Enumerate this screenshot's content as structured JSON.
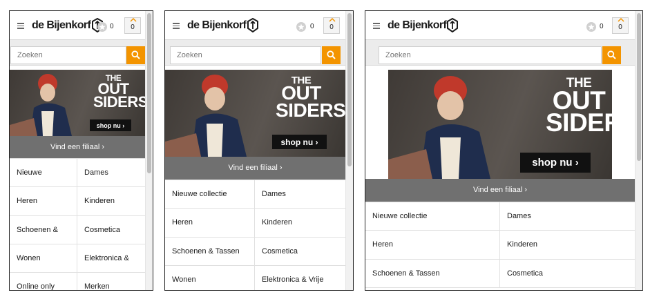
{
  "brand": {
    "logo_text": "de Bijenkorf",
    "accent_color": "#f39400"
  },
  "header": {
    "menu_icon": "hamburger-menu-icon",
    "wishlist_icon": "star-icon",
    "wishlist_count": "0",
    "cart_icon": "cart-chevron-icon",
    "cart_count": "0"
  },
  "search": {
    "placeholder": "Zoeken",
    "icon": "search-icon"
  },
  "banner": {
    "title_line1": "THE",
    "title_line2": "OUT",
    "title_line3": "SIDERS",
    "cta_label": "shop nu ›"
  },
  "find_store": {
    "label": "Vind een filiaal ›"
  },
  "screens": [
    {
      "nav": [
        [
          "Nieuwe",
          "Dames"
        ],
        [
          "Heren",
          "Kinderen"
        ],
        [
          "Schoenen &",
          "Cosmetica"
        ],
        [
          "Wonen",
          "Elektronica &"
        ],
        [
          "Online only",
          "Merken"
        ]
      ]
    },
    {
      "nav": [
        [
          "Nieuwe collectie",
          "Dames"
        ],
        [
          "Heren",
          "Kinderen"
        ],
        [
          "Schoenen & Tassen",
          "Cosmetica"
        ],
        [
          "Wonen",
          "Elektronica & Vrije"
        ]
      ]
    },
    {
      "nav": [
        [
          "Nieuwe collectie",
          "Dames"
        ],
        [
          "Heren",
          "Kinderen"
        ],
        [
          "Schoenen & Tassen",
          "Cosmetica"
        ]
      ]
    }
  ]
}
